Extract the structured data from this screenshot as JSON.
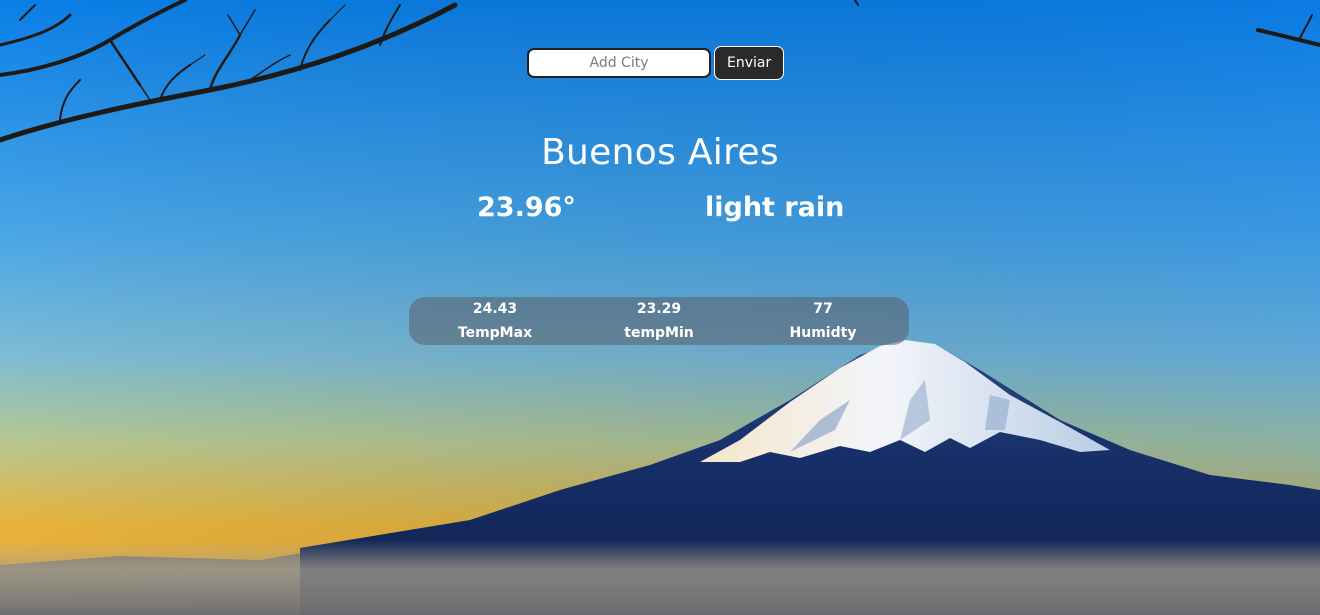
{
  "search": {
    "placeholder": "Add City",
    "value": "",
    "button_label": "Enviar"
  },
  "weather": {
    "city": "Buenos Aires",
    "temperature": "23.96°",
    "description": "light rain"
  },
  "stats": [
    {
      "value": "24.43",
      "label": "TempMax"
    },
    {
      "value": "23.29",
      "label": "tempMin"
    },
    {
      "value": "77",
      "label": "Humidty"
    }
  ],
  "colors": {
    "sky_top": "#0b7fe6",
    "sky_horizon": "#e9b53c",
    "mountain": "#13275e",
    "snow": "#e8eef6",
    "text": "#ffffff",
    "button_bg": "#2a2a2a"
  }
}
